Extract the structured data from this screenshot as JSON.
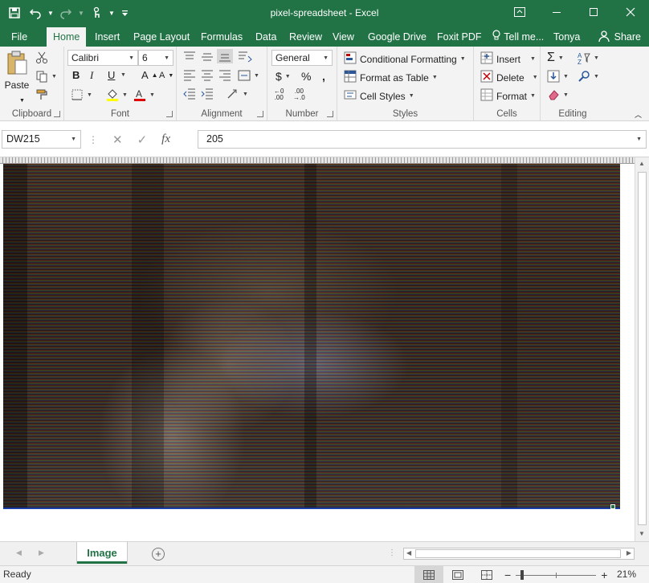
{
  "window": {
    "title": "pixel-spreadsheet - Excel"
  },
  "ribbon_tabs": [
    {
      "label": "File"
    },
    {
      "label": "Home"
    },
    {
      "label": "Insert"
    },
    {
      "label": "Page Layout"
    },
    {
      "label": "Formulas"
    },
    {
      "label": "Data"
    },
    {
      "label": "Review"
    },
    {
      "label": "View"
    },
    {
      "label": "Google Drive"
    },
    {
      "label": "Foxit PDF"
    },
    {
      "label": "Tell me..."
    },
    {
      "label": "Tonya"
    }
  ],
  "share_label": "Share",
  "clipboard": {
    "paste": "Paste",
    "group": "Clipboard"
  },
  "font": {
    "name": "Calibri",
    "size": "6",
    "bold": "B",
    "italic": "I",
    "underline": "U",
    "group": "Font"
  },
  "alignment": {
    "group": "Alignment"
  },
  "number": {
    "format": "General",
    "currency": "$",
    "percent": "%",
    "comma": ",",
    "group": "Number"
  },
  "styles": {
    "conditional": "Conditional Formatting",
    "format_table": "Format as Table",
    "cell_styles": "Cell Styles",
    "group": "Styles"
  },
  "cells": {
    "insert": "Insert",
    "delete": "Delete",
    "format": "Format",
    "group": "Cells"
  },
  "editing": {
    "group": "Editing"
  },
  "formula_bar": {
    "name_box": "DW215",
    "value": "205"
  },
  "sheets": [
    {
      "label": "Image",
      "active": true
    }
  ],
  "status": {
    "text": "Ready",
    "zoom": "21%",
    "zoom_fraction": 0.21
  },
  "colors": {
    "accent": "#217346",
    "selection": "#1b3ea8"
  }
}
